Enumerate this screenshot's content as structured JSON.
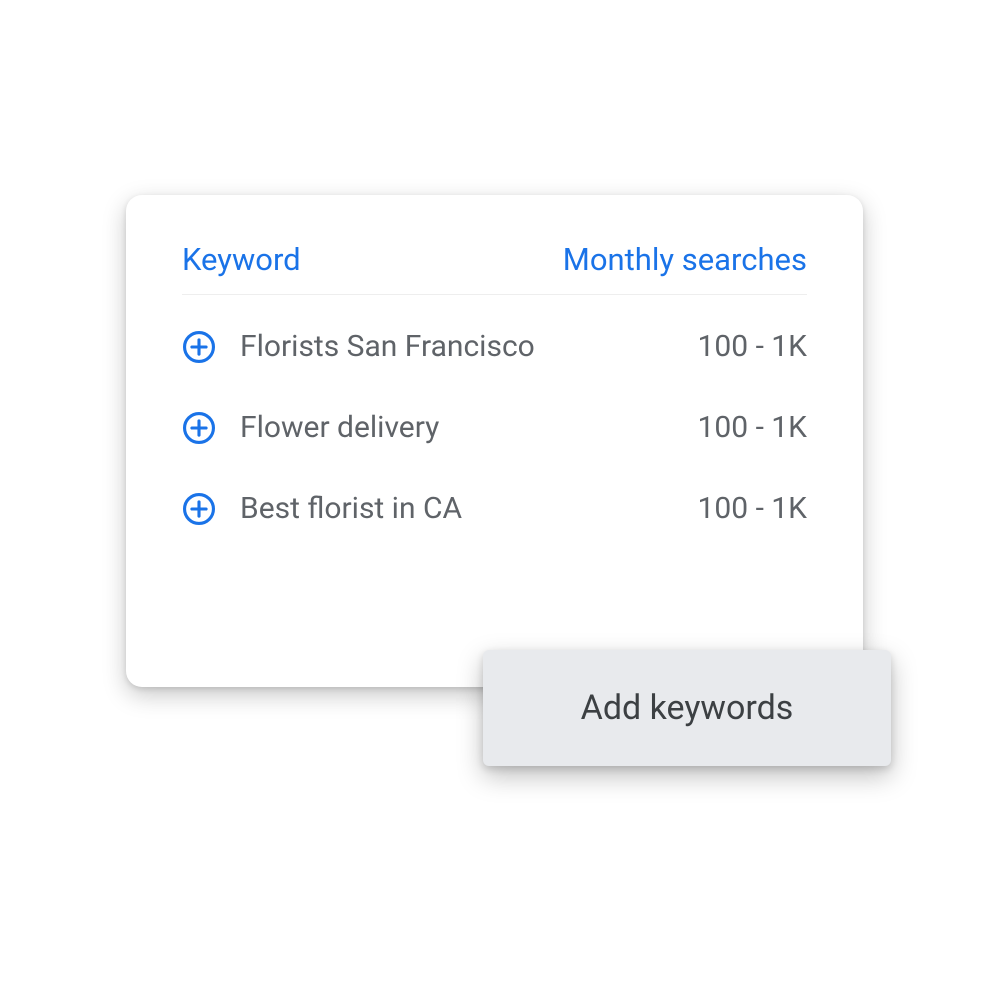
{
  "colors": {
    "blue": "#1a73e8",
    "gray_text": "#5f6368",
    "button_bg": "#e8eaed"
  },
  "table": {
    "header": {
      "keyword": "Keyword",
      "searches": "Monthly searches"
    },
    "rows": [
      {
        "keyword": "Florists San Francisco",
        "searches": "100 - 1K"
      },
      {
        "keyword": "Flower delivery",
        "searches": "100 - 1K"
      },
      {
        "keyword": "Best florist in CA",
        "searches": "100 - 1K"
      }
    ]
  },
  "button": {
    "add_keywords": "Add keywords"
  }
}
